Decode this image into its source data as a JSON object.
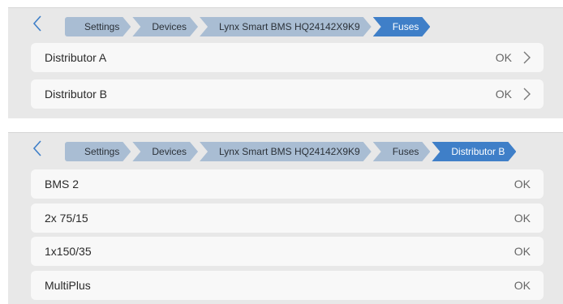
{
  "screen1": {
    "breadcrumbs": [
      "Settings",
      "Devices",
      "Lynx Smart BMS HQ24142X9K9",
      "Fuses"
    ],
    "rows": [
      {
        "label": "Distributor A",
        "status": "OK"
      },
      {
        "label": "Distributor B",
        "status": "OK"
      }
    ]
  },
  "screen2": {
    "breadcrumbs": [
      "Settings",
      "Devices",
      "Lynx Smart BMS HQ24142X9K9",
      "Fuses",
      "Distributor B"
    ],
    "rows": [
      {
        "label": "BMS 2",
        "status": "OK"
      },
      {
        "label": "2x 75/15",
        "status": "OK"
      },
      {
        "label": "1x150/35",
        "status": "OK"
      },
      {
        "label": "MultiPlus",
        "status": "OK"
      }
    ]
  },
  "icons": {
    "back": "chevron-left-icon",
    "row_nav": "chevron-right-icon"
  },
  "colors": {
    "accent": "#3f7fc8",
    "breadcrumb": "#a9bdd3",
    "panel": "#e8e8e8",
    "row": "#f8f8f8"
  }
}
